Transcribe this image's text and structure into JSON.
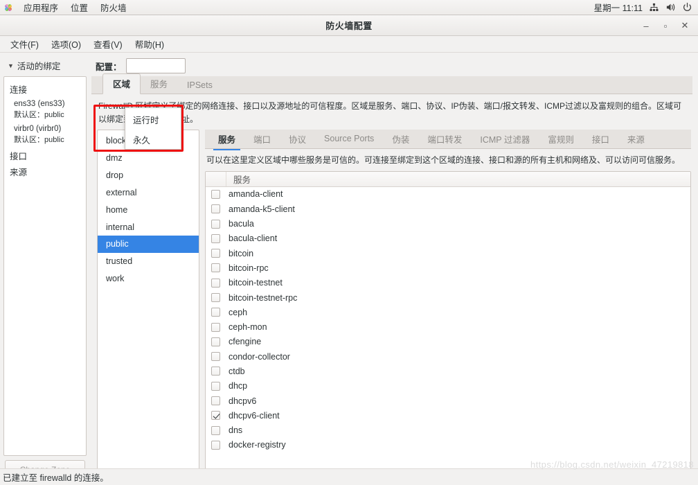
{
  "panel": {
    "app_icon": "fedora-pinwheel-icon",
    "items": [
      "应用程序",
      "位置",
      "防火墙"
    ],
    "clock": "星期一 11:11",
    "tray": [
      "network-icon",
      "volume-icon",
      "power-icon"
    ]
  },
  "window": {
    "title": "防火墙配置",
    "buttons": {
      "minimize": "–",
      "maximize": "▫",
      "close": "✕"
    }
  },
  "menubar": {
    "items": [
      "文件(F)",
      "选项(O)",
      "查看(V)",
      "帮助(H)"
    ]
  },
  "sidebar": {
    "header": "活动的绑定",
    "groups": [
      {
        "label": "连接",
        "entries": [
          {
            "name": "ens33 (ens33)",
            "zone": "默认区：public"
          },
          {
            "name": "virbr0 (virbr0)",
            "zone": "默认区：public"
          }
        ]
      },
      {
        "label": "接口",
        "entries": []
      },
      {
        "label": "来源",
        "entries": []
      }
    ],
    "change_zone_button": "Change Zone"
  },
  "config": {
    "label": "配置：",
    "selected": "运行时",
    "options": [
      "运行时",
      "永久"
    ]
  },
  "top_tabs": [
    {
      "label": "区域",
      "active": true
    },
    {
      "label": "服务",
      "active": false
    },
    {
      "label": "IPSets",
      "active": false
    }
  ],
  "zone_description": "FirewallD 区域定义了绑定的网络连接、接口以及源地址的可信程度。区域是服务、端口、协议、IP伪装、端口/报文转发、ICMP过滤以及富规则的组合。区域可以绑定到接口以及源地址。",
  "zones": [
    {
      "name": "block",
      "selected": false
    },
    {
      "name": "dmz",
      "selected": false
    },
    {
      "name": "drop",
      "selected": false
    },
    {
      "name": "external",
      "selected": false
    },
    {
      "name": "home",
      "selected": false
    },
    {
      "name": "internal",
      "selected": false
    },
    {
      "name": "public",
      "selected": true
    },
    {
      "name": "trusted",
      "selected": false
    },
    {
      "name": "work",
      "selected": false
    }
  ],
  "sub_tabs": [
    {
      "label": "服务",
      "active": true
    },
    {
      "label": "端口",
      "active": false
    },
    {
      "label": "协议",
      "active": false
    },
    {
      "label": "Source Ports",
      "active": false
    },
    {
      "label": "伪装",
      "active": false
    },
    {
      "label": "端口转发",
      "active": false
    },
    {
      "label": "ICMP 过滤器",
      "active": false
    },
    {
      "label": "富规则",
      "active": false
    },
    {
      "label": "接口",
      "active": false
    },
    {
      "label": "来源",
      "active": false
    }
  ],
  "services_description": "可以在这里定义区域中哪些服务是可信的。可连接至绑定到这个区域的连接、接口和源的所有主机和网络及、可以访问可信服务。",
  "services_table": {
    "header": "服务",
    "rows": [
      {
        "name": "amanda-client",
        "checked": false
      },
      {
        "name": "amanda-k5-client",
        "checked": false
      },
      {
        "name": "bacula",
        "checked": false
      },
      {
        "name": "bacula-client",
        "checked": false
      },
      {
        "name": "bitcoin",
        "checked": false
      },
      {
        "name": "bitcoin-rpc",
        "checked": false
      },
      {
        "name": "bitcoin-testnet",
        "checked": false
      },
      {
        "name": "bitcoin-testnet-rpc",
        "checked": false
      },
      {
        "name": "ceph",
        "checked": false
      },
      {
        "name": "ceph-mon",
        "checked": false
      },
      {
        "name": "cfengine",
        "checked": false
      },
      {
        "name": "condor-collector",
        "checked": false
      },
      {
        "name": "ctdb",
        "checked": false
      },
      {
        "name": "dhcp",
        "checked": false
      },
      {
        "name": "dhcpv6",
        "checked": false
      },
      {
        "name": "dhcpv6-client",
        "checked": true
      },
      {
        "name": "dns",
        "checked": false
      },
      {
        "name": "docker-registry",
        "checked": false
      }
    ]
  },
  "statusbar": {
    "text": "已建立至 firewalld 的连接。"
  },
  "watermark": "https://blog.csdn.net/weixin_47219818",
  "colors": {
    "accent": "#3584e4",
    "annotation": "#ee1111",
    "panel_bg": "#f2f1f0"
  }
}
